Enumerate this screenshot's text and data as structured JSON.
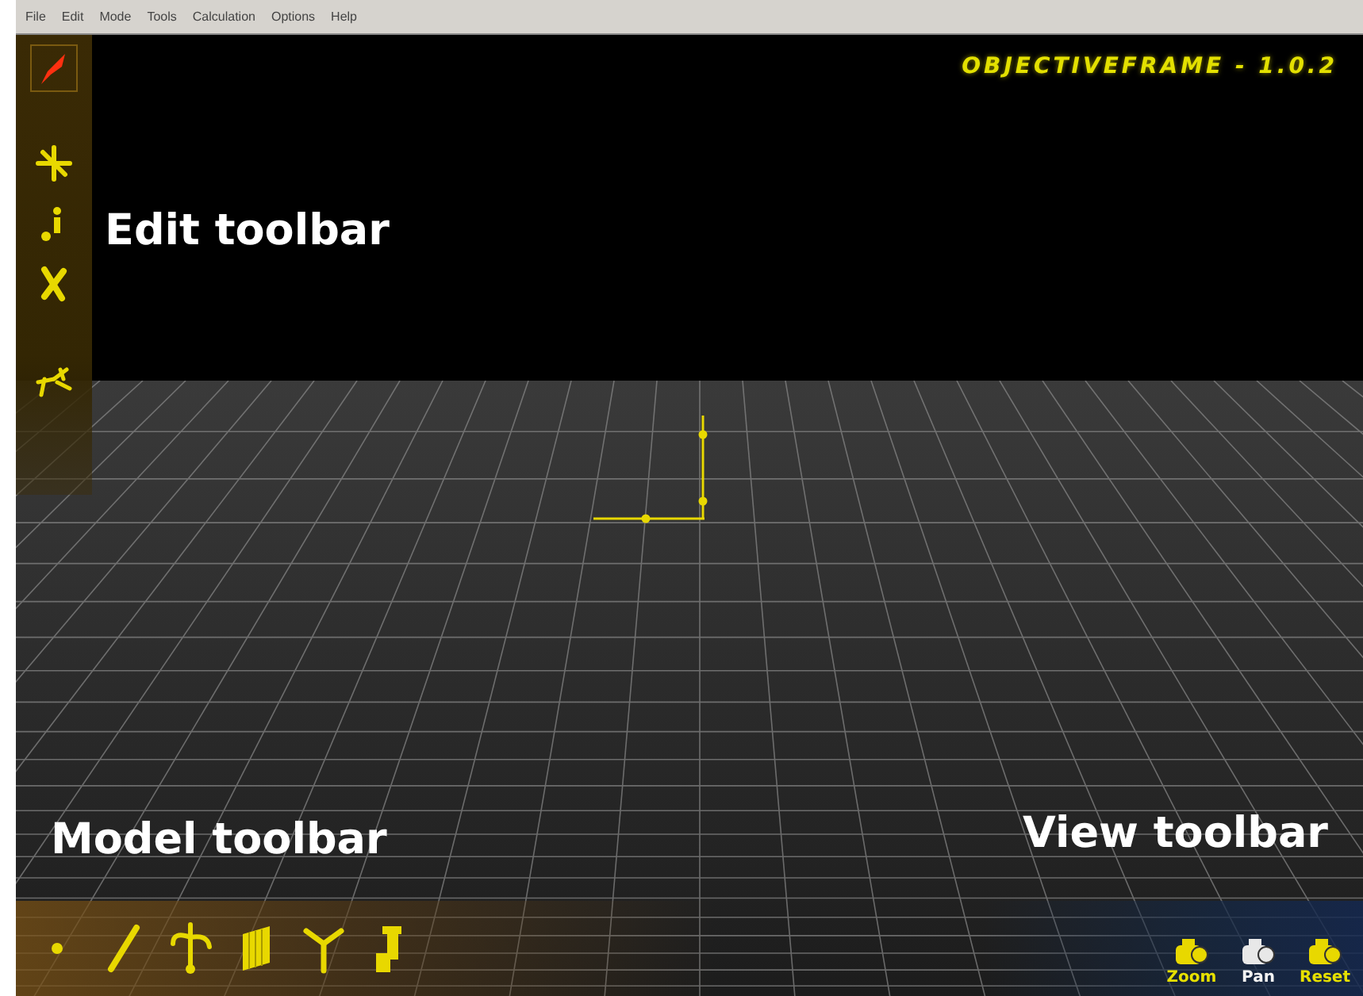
{
  "menu": [
    "File",
    "Edit",
    "Mode",
    "Tools",
    "Calculation",
    "Options",
    "Help"
  ],
  "title": "OBJECTIVEFRAME - 1.0.2",
  "edit_toolbar": {
    "label": "Edit toolbar",
    "tools": [
      {
        "kind": "pencil",
        "selected": true
      },
      {
        "kind": "move",
        "selected": false
      },
      {
        "kind": "info",
        "selected": false
      },
      {
        "kind": "delete",
        "selected": false
      },
      {
        "kind": "snap",
        "selected": false
      }
    ]
  },
  "model_toolbar": {
    "label": "Model toolbar",
    "tools": [
      {
        "kind": "node"
      },
      {
        "kind": "beam"
      },
      {
        "kind": "support"
      },
      {
        "kind": "panel"
      },
      {
        "kind": "branch"
      },
      {
        "kind": "column"
      }
    ]
  },
  "view_toolbar": {
    "label": "View toolbar",
    "buttons": [
      {
        "label": "Zoom",
        "selected": false
      },
      {
        "label": "Pan",
        "selected": true
      },
      {
        "label": "Reset",
        "selected": false
      }
    ]
  }
}
